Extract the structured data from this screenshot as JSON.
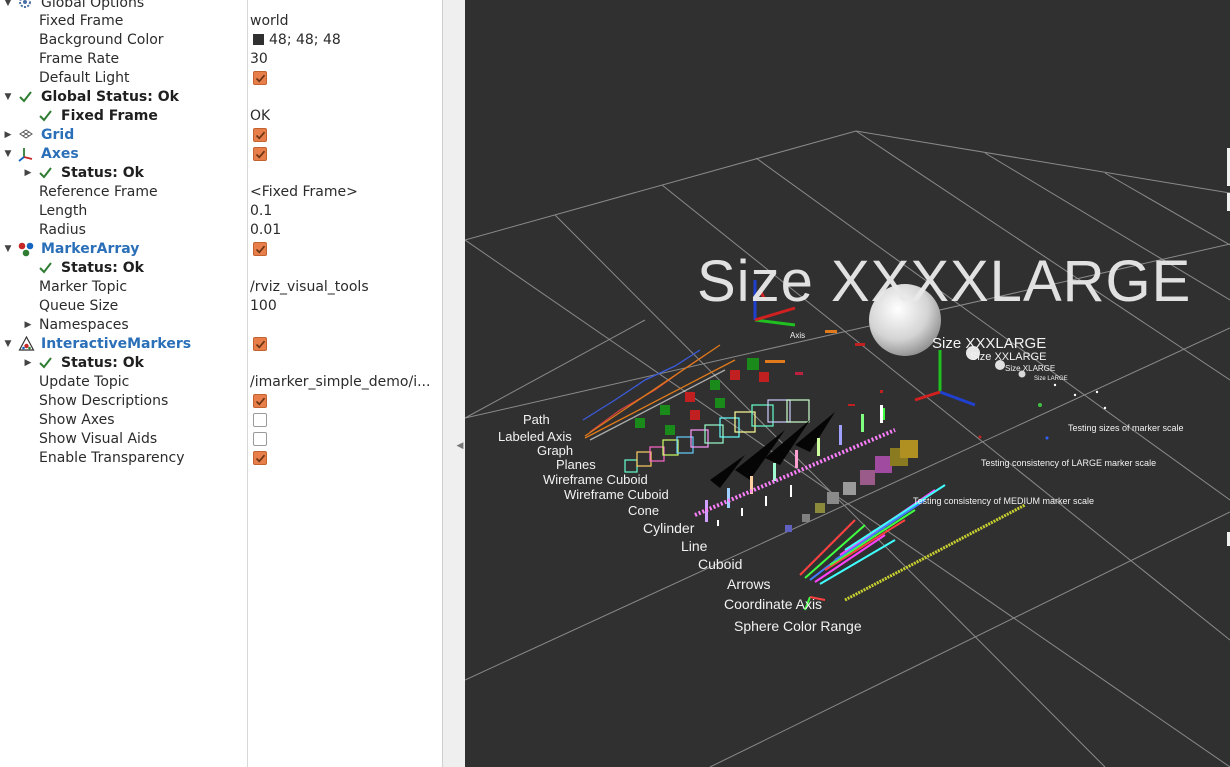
{
  "tree": {
    "global_options": {
      "label": "Global Options"
    },
    "fixed_frame": {
      "label": "Fixed Frame",
      "value": "world"
    },
    "background_color": {
      "label": "Background Color",
      "value": "48; 48; 48",
      "swatch": "#303030"
    },
    "frame_rate": {
      "label": "Frame Rate",
      "value": "30"
    },
    "default_light": {
      "label": "Default Light",
      "checked": true
    },
    "global_status": {
      "label": "Global Status: Ok"
    },
    "fixed_frame_status": {
      "label": "Fixed Frame",
      "value": "OK"
    },
    "grid": {
      "label": "Grid",
      "checked": true
    },
    "axes": {
      "label": "Axes",
      "checked": true
    },
    "axes_status": {
      "label": "Status: Ok"
    },
    "axes_reference_frame": {
      "label": "Reference Frame",
      "value": "<Fixed Frame>"
    },
    "axes_length": {
      "label": "Length",
      "value": "0.1"
    },
    "axes_radius": {
      "label": "Radius",
      "value": "0.01"
    },
    "marker_array": {
      "label": "MarkerArray",
      "checked": true
    },
    "marker_array_status": {
      "label": "Status: Ok"
    },
    "marker_topic": {
      "label": "Marker Topic",
      "value": "/rviz_visual_tools"
    },
    "queue_size": {
      "label": "Queue Size",
      "value": "100"
    },
    "namespaces": {
      "label": "Namespaces"
    },
    "interactive_markers": {
      "label": "InteractiveMarkers",
      "checked": true
    },
    "im_status": {
      "label": "Status: Ok"
    },
    "update_topic": {
      "label": "Update Topic",
      "value": "/imarker_simple_demo/i..."
    },
    "show_descriptions": {
      "label": "Show Descriptions",
      "checked": true
    },
    "show_axes": {
      "label": "Show Axes",
      "checked": false
    },
    "show_visual_aids": {
      "label": "Show Visual Aids",
      "checked": false
    },
    "enable_transparency": {
      "label": "Enable Transparency",
      "checked": true
    }
  },
  "scene": {
    "background": "#303030",
    "big_title": "Size  XXXXLARGE",
    "size_labels": [
      "Size  XXXLARGE",
      "Size  XXLARGE",
      "Size  XLARGE",
      "Size  LARGE"
    ],
    "axis_tiny": "Axis",
    "test_labels": [
      "Testing  sizes  of  marker  scale",
      "Testing  consistency  of  LARGE  marker  scale",
      "Testing  consistency  of  MEDIUM  marker  scale"
    ],
    "marker_labels": [
      "Path",
      "Labeled  Axis",
      "Graph",
      "Planes",
      "Wireframe  Cuboid",
      "Wireframe  Cuboid",
      "Cone",
      "Cylinder",
      "Line",
      "Cuboid",
      "Arrows",
      "Coordinate  Axis",
      "Sphere  Color  Range"
    ]
  }
}
